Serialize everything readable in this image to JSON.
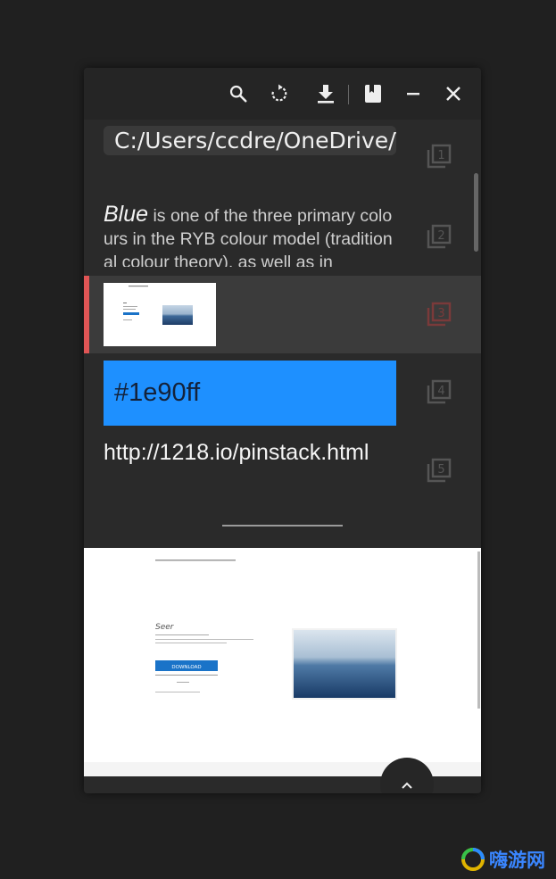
{
  "toolbar": {
    "icons": [
      "search-icon",
      "refresh-icon",
      "download-icon",
      "book-icon",
      "minimize-icon",
      "close-icon"
    ]
  },
  "items": [
    {
      "index": 1,
      "type": "path",
      "text": "C:/Users/ccdre/OneDrive/Ti"
    },
    {
      "index": 2,
      "type": "text",
      "lead": "Blue",
      "body": " is one of the three primary colours in the RYB colour model (traditional colour theory), as well as in"
    },
    {
      "index": 3,
      "type": "image",
      "selected": true
    },
    {
      "index": 4,
      "type": "color",
      "text": "#1e90ff",
      "color": "#1e90ff"
    },
    {
      "index": 5,
      "type": "url",
      "text": "http://1218.io/pinstack.html"
    }
  ],
  "preview": {
    "page_title": "Seer",
    "button_label": "DOWNLOAD"
  },
  "watermark": {
    "text": "嗨游网"
  },
  "colors": {
    "accent": "#e05555",
    "selection": "#3b3b3b",
    "chip_blue": "#1e90ff"
  }
}
